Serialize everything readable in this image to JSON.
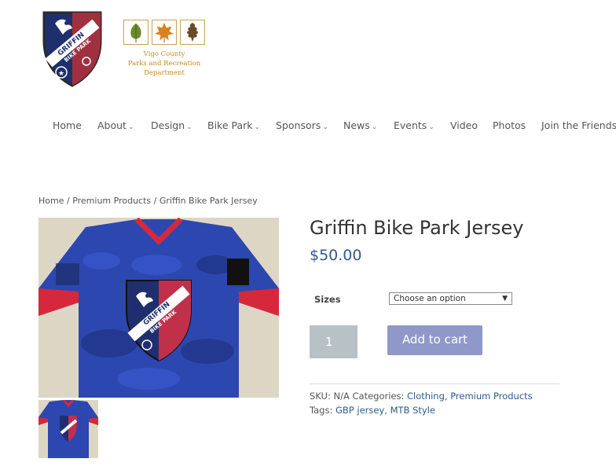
{
  "header": {
    "griffin_logo": {
      "line1": "GRIFFIN",
      "line2": "BIKE PARK"
    },
    "vigo_logo": {
      "line1": "Vigo County",
      "line2": "Parks and Recreation",
      "line3": "Department"
    }
  },
  "nav": {
    "items": [
      {
        "label": "Home",
        "has_dropdown": false
      },
      {
        "label": "About",
        "has_dropdown": true
      },
      {
        "label": "Design",
        "has_dropdown": true
      },
      {
        "label": "Bike Park",
        "has_dropdown": true
      },
      {
        "label": "Sponsors",
        "has_dropdown": true
      },
      {
        "label": "News",
        "has_dropdown": true
      },
      {
        "label": "Events",
        "has_dropdown": true
      },
      {
        "label": "Video",
        "has_dropdown": false
      },
      {
        "label": "Photos",
        "has_dropdown": false
      },
      {
        "label": "Join the Friends!",
        "has_dropdown": false
      }
    ],
    "caret": "⌄"
  },
  "breadcrumb": {
    "home": "Home",
    "sep": " / ",
    "category": "Premium Products",
    "current": "Griffin Bike Park Jersey"
  },
  "product": {
    "title": "Griffin Bike Park Jersey",
    "price": "$50.00",
    "sizes_label": "Sizes",
    "size_select_value": "Choose an option",
    "quantity": "1",
    "add_to_cart_label": "Add to cart",
    "jersey_logo": {
      "line1": "GRIFFIN",
      "line2": "BIKE PARK"
    }
  },
  "meta": {
    "sku_label": "SKU:",
    "sku_value": "N/A",
    "categories_label": "Categories:",
    "categories": [
      "Clothing",
      "Premium Products"
    ],
    "tags_label": "Tags:",
    "tags": [
      "GBP jersey",
      "MTB Style"
    ],
    "comma": ","
  },
  "colors": {
    "shield_navy": "#1f2f6e",
    "shield_red": "#c0304a",
    "jersey_blue": "#2c47b0",
    "jersey_red": "#d6283c",
    "link": "#2e5a8e",
    "button": "#8f98c8"
  }
}
